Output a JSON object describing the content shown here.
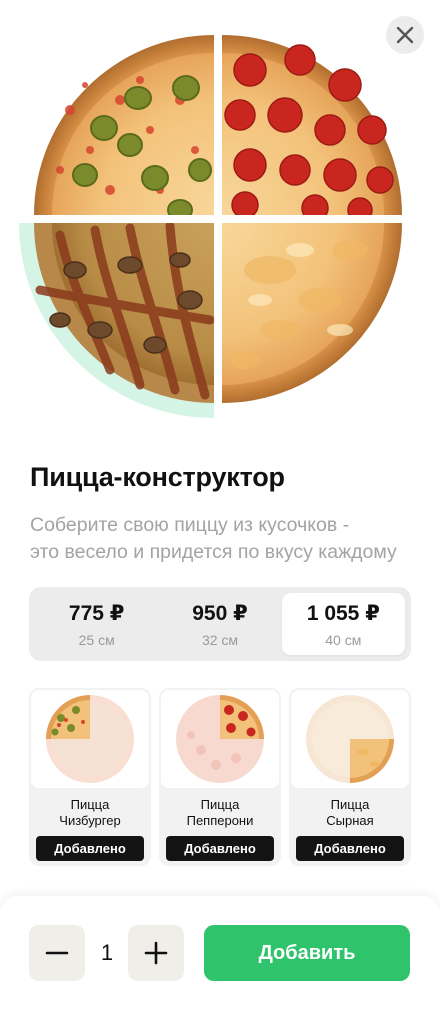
{
  "product": {
    "title": "Пицца-конструктор",
    "description_lines": [
      "Соберите свою пиццу из кусочков -",
      "это весело и придется по вкусу каждому"
    ]
  },
  "sizes": [
    {
      "price": "775 ₽",
      "diameter": "25 см",
      "selected": false
    },
    {
      "price": "950 ₽",
      "diameter": "32 см",
      "selected": false
    },
    {
      "price": "1 055 ₽",
      "diameter": "40 см",
      "selected": true
    }
  ],
  "pieces": [
    {
      "name_line1": "Пицца",
      "name_line2": "Чизбургер",
      "badge": "Добавлено"
    },
    {
      "name_line1": "Пицца",
      "name_line2": "Пепперони",
      "badge": "Добавлено"
    },
    {
      "name_line1": "Пицца",
      "name_line2": "Сырная",
      "badge": "Добавлено"
    }
  ],
  "cart": {
    "quantity": "1",
    "add_label": "Добавить"
  },
  "icons": {
    "close": "close-icon",
    "minus": "minus-icon",
    "plus": "plus-icon"
  },
  "colors": {
    "accent_green": "#2fc46b",
    "empty_slot_mint": "#d4f4e6",
    "badge_dark": "#141414"
  }
}
